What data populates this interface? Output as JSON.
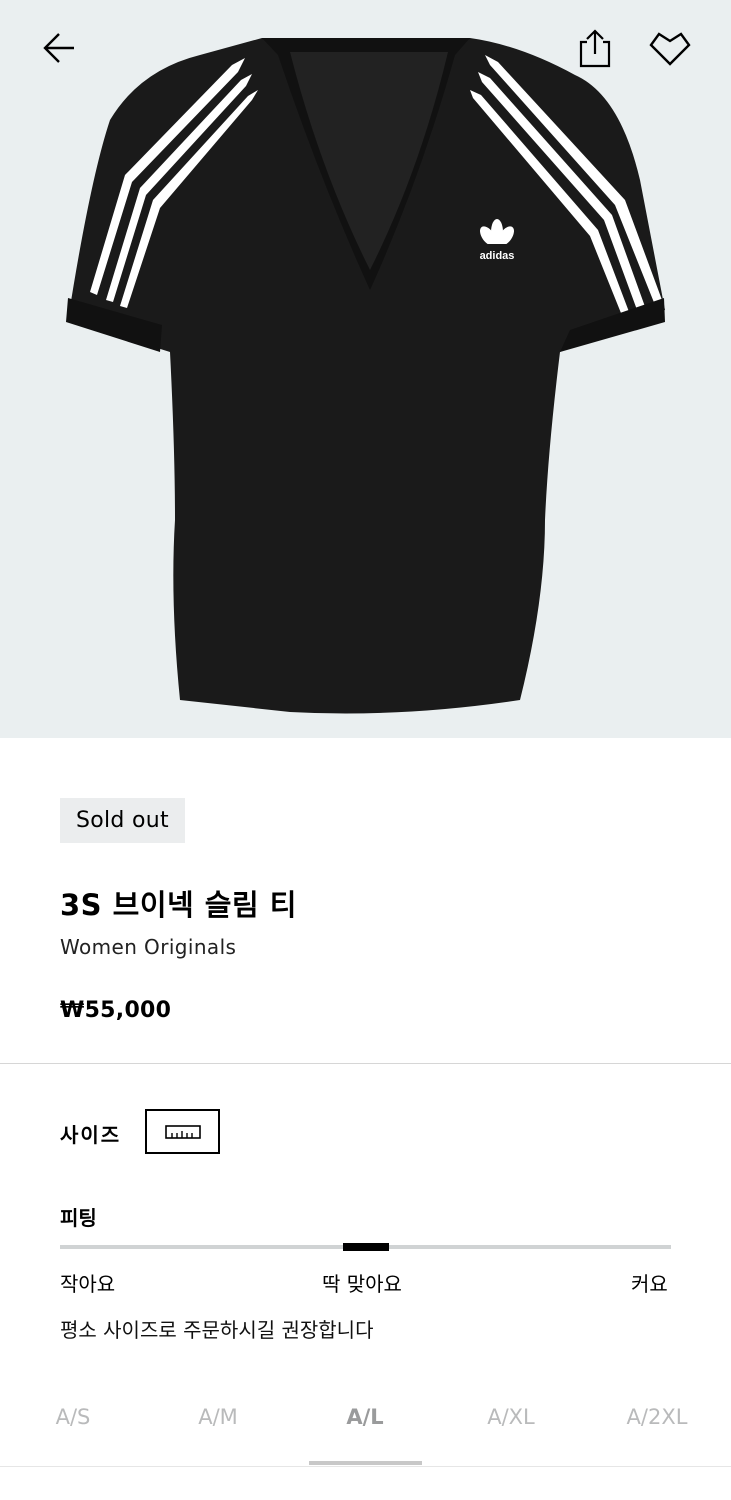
{
  "product": {
    "badge": "Sold out",
    "title": "3S 브이넥 슬림 티",
    "subtitle": "Women Originals",
    "price": "₩55,000",
    "image_logo_text": "adidas"
  },
  "icons": {
    "back": "arrow-left-icon",
    "share": "share-icon",
    "wishlist": "heart-icon",
    "size_guide": "ruler-icon"
  },
  "size": {
    "label": "사이즈"
  },
  "fit": {
    "label": "피팅",
    "low": "작아요",
    "mid": "딱 맞아요",
    "high": "커요",
    "note": "평소 사이즈로 주문하시길 권장합니다",
    "position": 0.5
  },
  "size_tabs": [
    {
      "label": "A/S",
      "active": false
    },
    {
      "label": "A/M",
      "active": false
    },
    {
      "label": "A/L",
      "active": true
    },
    {
      "label": "A/XL",
      "active": false
    },
    {
      "label": "A/2XL",
      "active": false
    }
  ],
  "colors": {
    "hero_bg": "#eaeff0",
    "badge_bg": "#ebedee",
    "shirt": "#1a1a1a",
    "stripe": "#ffffff"
  }
}
